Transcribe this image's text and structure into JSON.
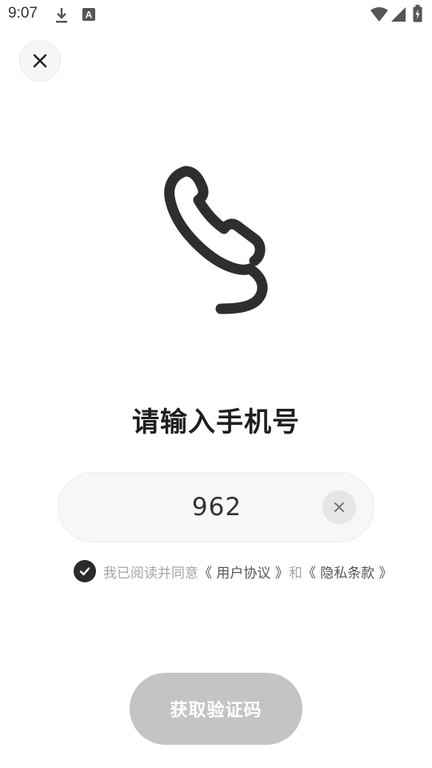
{
  "status_bar": {
    "time": "9:07",
    "icons": [
      "download-icon",
      "a-badge-icon",
      "wifi-icon",
      "signal-icon",
      "battery-charging-icon"
    ],
    "a_badge_letter": "A"
  },
  "header": {
    "close_icon": "close-icon"
  },
  "illustration": {
    "icon": "phone-handset-icon"
  },
  "main": {
    "title": "请输入手机号",
    "phone_input": {
      "value": "962",
      "placeholder": ""
    },
    "clear_icon": "clear-icon"
  },
  "agreement": {
    "checked": true,
    "prefix": "我已阅读并同意",
    "user_agreement": "《 用户协议 》",
    "and": "和",
    "privacy_policy": "《 隐私条款 》"
  },
  "actions": {
    "get_code_label": "获取验证码"
  },
  "colors": {
    "background": "#ffffff",
    "title": "#1f1f1f",
    "button_disabled": "#c4c4c4",
    "checkbox": "#2b2b2b",
    "hint_text": "#a6a6a6",
    "link_text": "#555555",
    "input_bg": "#f7f7f7"
  }
}
